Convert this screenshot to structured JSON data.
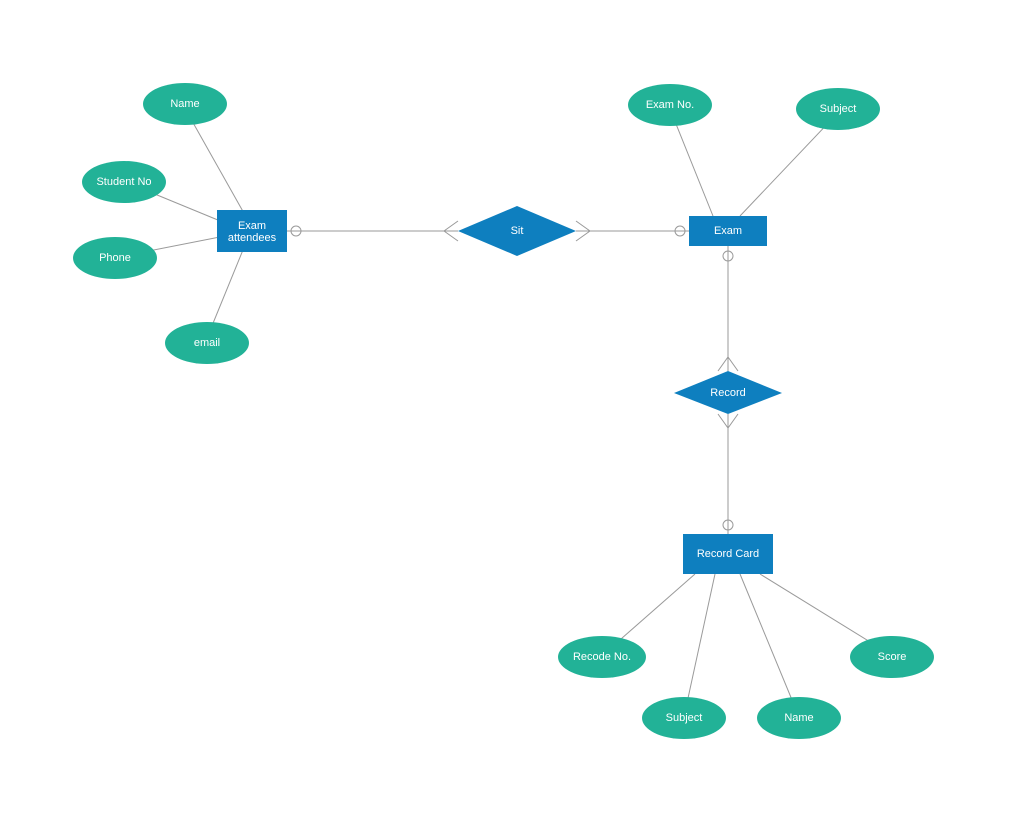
{
  "entities": {
    "examAttendees": {
      "label": "Exam attendees",
      "attributes": {
        "name": "Name",
        "studentNo": "Student No",
        "phone": "Phone",
        "email": "email"
      }
    },
    "exam": {
      "label": "Exam",
      "attributes": {
        "examNo": "Exam No.",
        "subject": "Subject"
      }
    },
    "recordCard": {
      "label": "Record Card",
      "attributes": {
        "recodeNo": "Recode No.",
        "subject": "Subject",
        "name": "Name",
        "score": "Score"
      }
    }
  },
  "relationships": {
    "sit": "Sit",
    "record": "Record"
  },
  "colors": {
    "entity": "#0e7fbf",
    "attribute": "#22b297",
    "connector": "#9a9a9a"
  }
}
